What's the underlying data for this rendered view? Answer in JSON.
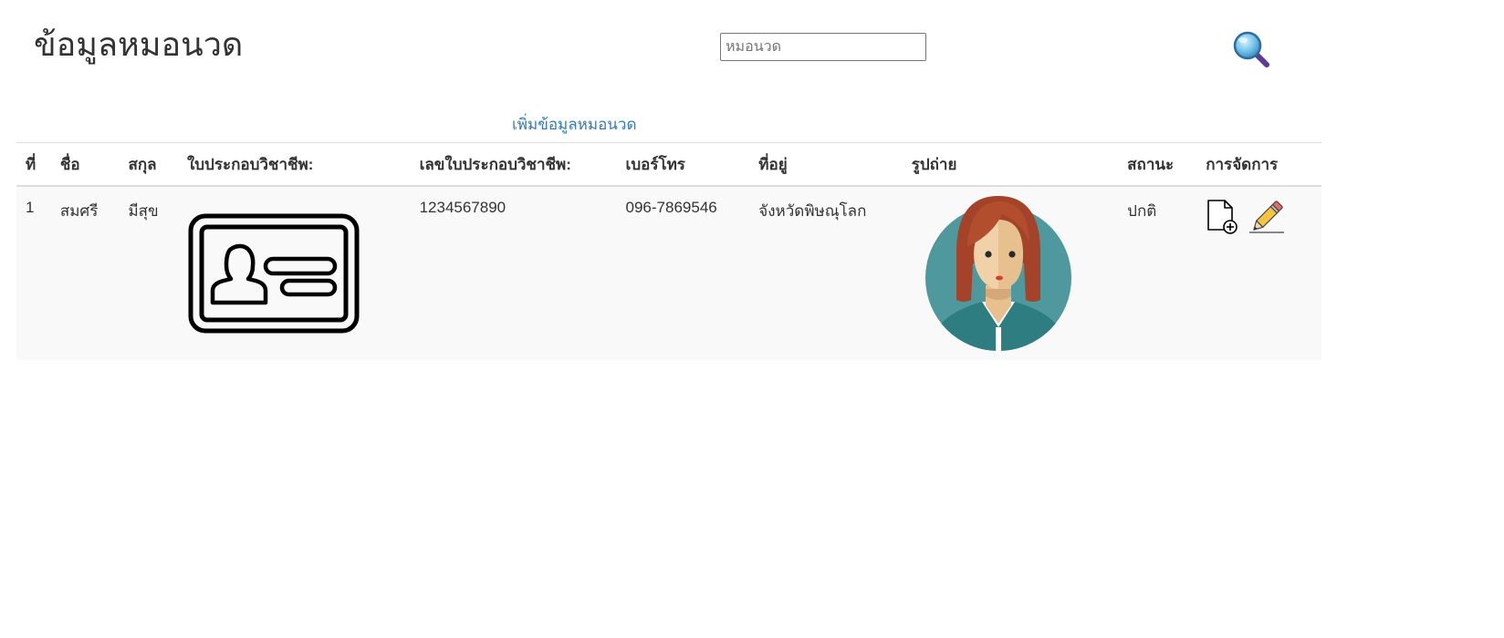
{
  "page": {
    "title": "ข้อมูลหมอนวด"
  },
  "search": {
    "placeholder": "หมอนวด",
    "value": ""
  },
  "add_link": {
    "label": "เพิ่มข้อมูลหมอนวด"
  },
  "table": {
    "headers": {
      "no": "ที่",
      "first_name": "ชื่อ",
      "last_name": "สกุล",
      "license": "ใบประกอบวิชาชีพ:",
      "license_no": "เลขใบประกอบวิชาชีพ:",
      "phone": "เบอร์โทร",
      "address": "ที่อยู่",
      "photo": "รูปถ่าย",
      "status": "สถานะ",
      "actions": "การจัดการ"
    },
    "rows": [
      {
        "no": "1",
        "first_name": "สมศรี",
        "last_name": "มีสุข",
        "license_no": "1234567890",
        "phone": "096-7869546",
        "address": "จังหวัดพิษณุโลก",
        "status": "ปกติ"
      }
    ]
  },
  "icons": {
    "search": "magnifier-icon",
    "license": "id-card-icon",
    "photo": "female-avatar",
    "add_document": "add-document-icon",
    "edit": "pencil-icon"
  }
}
